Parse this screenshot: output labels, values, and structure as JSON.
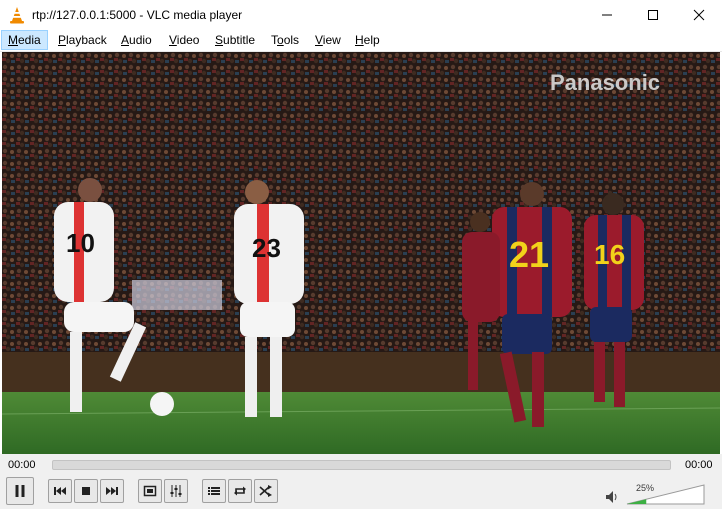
{
  "window": {
    "title": "rtp://127.0.0.1:5000 - VLC media player"
  },
  "menu": {
    "items": [
      {
        "label": "Media"
      },
      {
        "label": "Playback"
      },
      {
        "label": "Audio"
      },
      {
        "label": "Video"
      },
      {
        "label": "Subtitle"
      },
      {
        "label": "Tools"
      },
      {
        "label": "View"
      },
      {
        "label": "Help"
      }
    ],
    "active": "Media"
  },
  "video": {
    "watermark": "Panasonic",
    "players": [
      {
        "number": "10"
      },
      {
        "number": "23"
      },
      {
        "number": "21"
      },
      {
        "number": "16"
      }
    ]
  },
  "seek": {
    "elapsed": "00:00",
    "total": "00:00",
    "progress": 0
  },
  "volume": {
    "percent_label": "25%",
    "level": 0.25
  },
  "icons": {
    "app": "vlc-cone-icon",
    "minimize": "minimize-icon",
    "maximize": "maximize-icon",
    "close": "close-icon",
    "pause": "pause-icon",
    "previous": "previous-icon",
    "stop": "stop-icon",
    "next": "next-icon",
    "fullscreen": "fullscreen-icon",
    "extended": "extended-settings-icon",
    "playlist": "playlist-icon",
    "loop": "loop-icon",
    "random": "shuffle-icon",
    "speaker": "speaker-icon"
  },
  "colors": {
    "vlc_orange": "#f08a00",
    "pitch_green": "#3f7a2c",
    "barca_red": "#9b1b2c",
    "barca_yellow": "#f2d21a",
    "volume_green": "#3cb043"
  }
}
